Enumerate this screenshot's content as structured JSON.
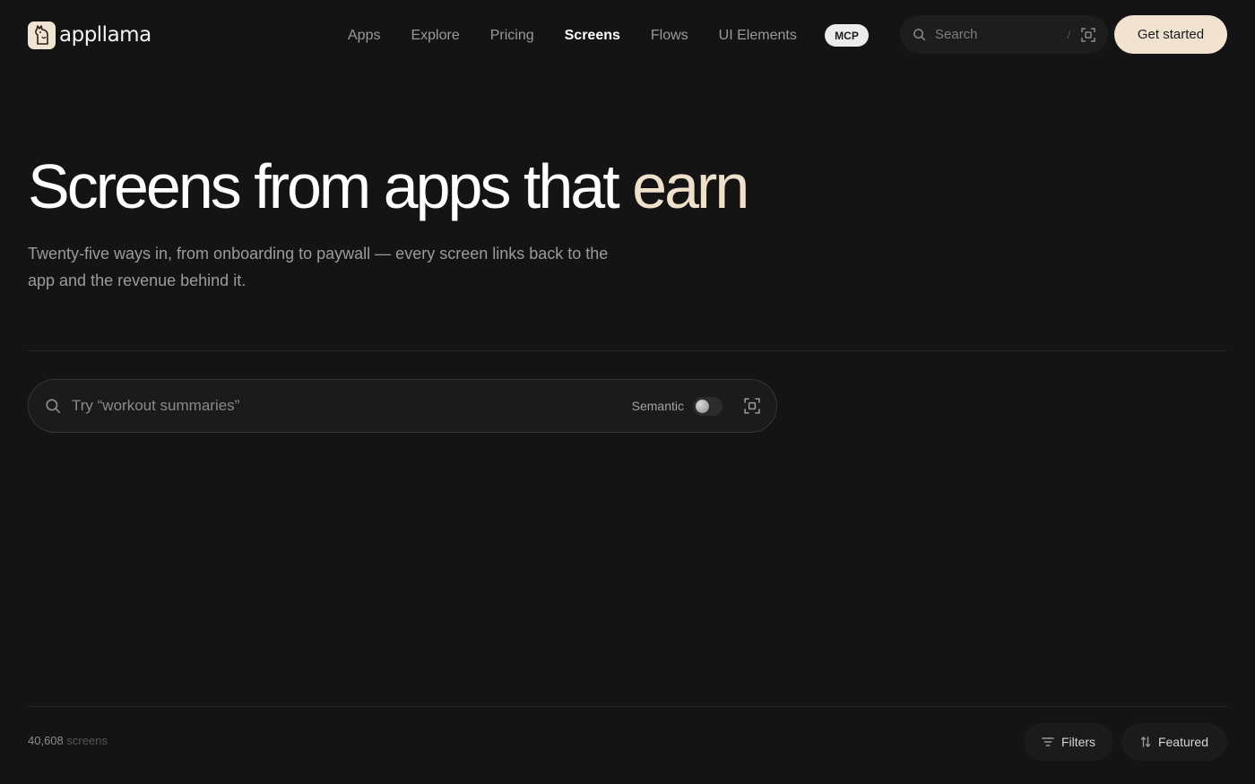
{
  "header": {
    "brand": "appllama",
    "nav": [
      {
        "label": "Apps"
      },
      {
        "label": "Explore"
      },
      {
        "label": "Pricing"
      },
      {
        "label": "Screens",
        "active": true
      },
      {
        "label": "Flows"
      },
      {
        "label": "UI Elements"
      }
    ],
    "mcp_label": "MCP",
    "search": {
      "placeholder": "Search",
      "shortcut": "/"
    },
    "cta_label": "Get started"
  },
  "hero": {
    "title_main": "Screens from apps that ",
    "title_accent": "earn",
    "subtitle": "Twenty-five ways in, from onboarding to paywall — every screen links back to the app and the revenue behind it."
  },
  "main_search": {
    "placeholder": "Try “workout summaries”",
    "semantic_label": "Semantic",
    "semantic_enabled": false
  },
  "results": {
    "count": "40,608",
    "unit": "screens",
    "filters_label": "Filters",
    "sort_label": "Featured"
  },
  "colors": {
    "background": "#141414",
    "accent": "#efe0cc",
    "cta_bg": "#f2e3d0"
  },
  "icons": [
    "llama-logo-icon",
    "search-icon",
    "scan-icon",
    "filter-icon",
    "sort-icon"
  ]
}
